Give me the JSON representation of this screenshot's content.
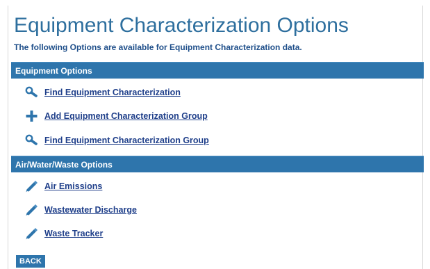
{
  "page": {
    "title": "Equipment Characterization Options",
    "subtitle": "The following Options are available for Equipment Characterization data."
  },
  "sections": [
    {
      "header": "Equipment Options",
      "items": [
        {
          "icon": "magnifier-icon",
          "label": "Find Equipment Characterization"
        },
        {
          "icon": "plus-icon",
          "label": "Add Equipment Characterization Group"
        },
        {
          "icon": "magnifier-icon",
          "label": "Find Equipment Characterization Group"
        }
      ]
    },
    {
      "header": "Air/Water/Waste Options",
      "items": [
        {
          "icon": "pencil-icon",
          "label": "Air Emissions"
        },
        {
          "icon": "pencil-icon",
          "label": "Wastewater Discharge"
        },
        {
          "icon": "pencil-icon",
          "label": "Waste Tracker"
        }
      ]
    }
  ],
  "back_button": "BACK",
  "colors": {
    "title": "#2e6f9e",
    "header_bg": "#2e75ac",
    "link": "#1f3f8a",
    "icon": "#2e75ac"
  }
}
